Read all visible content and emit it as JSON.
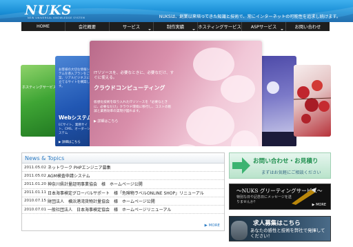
{
  "header": {
    "logo": "NUKS",
    "logo_sub": "NEW UNIVERSAL KNOWLEDGE SYSTEM",
    "tagline": "NUKSは、創業以来培ってきた知識と技術で、常にインターネットの可能性を追求し続けます。"
  },
  "nav": {
    "items": [
      {
        "label": "HOME",
        "has_menu": false
      },
      {
        "label": "会社概要",
        "has_menu": false
      },
      {
        "label": "サービス",
        "has_menu": true
      },
      {
        "label": "制作実績",
        "has_menu": true
      },
      {
        "label": "ホスティングサービス",
        "has_menu": false
      },
      {
        "label": "ASPサービス",
        "has_menu": true
      },
      {
        "label": "お問い合わせ",
        "has_menu": false
      }
    ]
  },
  "slider": {
    "left_panel_text": "ホスティングサービス",
    "web": {
      "small": "お客様の大切な情報システムを導入プランをご提案、リアルビジネスに役立てるサイトを構築します。",
      "title": "Webシステム",
      "desc": "ECサイト、業務サイト、CMS、オーダーシステム",
      "more": "▶ 詳細はこちら"
    },
    "featured": {
      "intro": "ITリソースを、必要なときに、必要なだけ、すぐに使える。",
      "title": "クラウドコンピューティング",
      "desc": "仮想化技術を取り入れたITリソースを「必要なときに、必要なだけ」クラウド環境に移行し、コストの削減と業務効率の実現が図れます。",
      "more": "▶ 詳細はこちら"
    }
  },
  "news": {
    "heading": "News & Topics",
    "items": [
      {
        "date": "2011.05.02",
        "title": "ネットワーク PHPエンジニア募集"
      },
      {
        "date": "2011.05.02",
        "title": "AGM検査申請システム"
      },
      {
        "date": "2011.01.20",
        "title": "神奈川県計量証明事業協会　様　ホームページ公開"
      },
      {
        "date": "2011.01.11",
        "title": "日本海事検定グローバルサポート　様「危険物ラベルONLINE SHOP」リニューアル"
      },
      {
        "date": "2010.07.15",
        "title": "財団法人　横浜港湾貨物計量協会　様　ホームページ公開"
      },
      {
        "date": "2010.07.01",
        "title": "一般社団法人　日本海事検定協会　様　ホームページリニューアル"
      }
    ],
    "more": "▶ MORE"
  },
  "banners": {
    "contact_title": "お問い合わせ・お見積り",
    "contact_sub": "まずはお気軽にご相談ください",
    "greeting_title": "〜NUKS グリーティングサービス〜",
    "greeting_sub": "特別な日や記念日にメッセージを送りませんか？",
    "greeting_more": "▶ MORE",
    "recruit_title": "求人募集はこちら",
    "recruit_sub": "あなたの感性と技術を弊社で発揮してください！"
  },
  "colors": {
    "header_blue": "#1a8fd6",
    "nav_bg": "#1e1e1e",
    "news_heading": "#2d7cc4",
    "contact_green": "#1f8f4e"
  }
}
